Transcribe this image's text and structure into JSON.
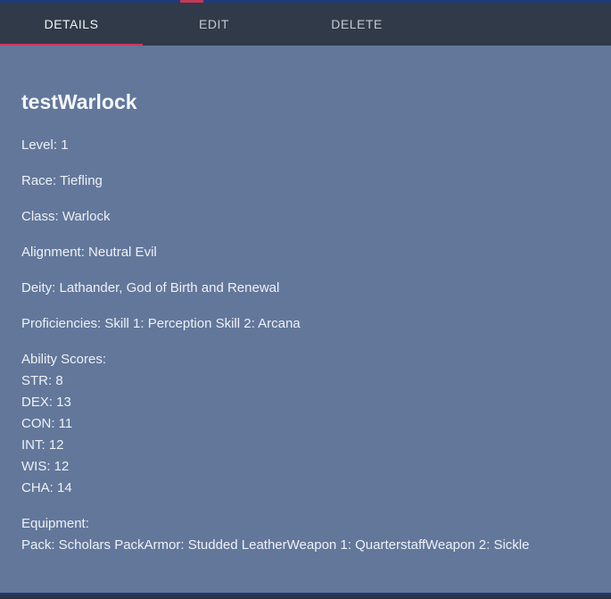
{
  "tabs": {
    "details": "DETAILS",
    "edit": "EDIT",
    "delete": "DELETE"
  },
  "character": {
    "name": "testWarlock",
    "level": "Level: 1",
    "race": "Race: Tiefling",
    "class": "Class: Warlock",
    "alignment": "Alignment: Neutral Evil",
    "deity": "Deity: Lathander, God of Birth and Renewal",
    "proficiencies": "Proficiencies: Skill 1: Perception Skill 2: Arcana",
    "ability_header": "Ability Scores:",
    "abilities": {
      "str": "STR: 8",
      "dex": "DEX: 13",
      "con": "CON: 11",
      "int": "INT: 12",
      "wis": "WIS: 12",
      "cha": "CHA: 14"
    },
    "equipment_header": "Equipment:",
    "equipment": "Pack: Scholars PackArmor: Studded LeatherWeapon 1: QuarterstaffWeapon 2: Sickle"
  },
  "colors": {
    "background": "#62779a",
    "tabbar": "#313a48",
    "active_indicator": "#d1345b"
  }
}
